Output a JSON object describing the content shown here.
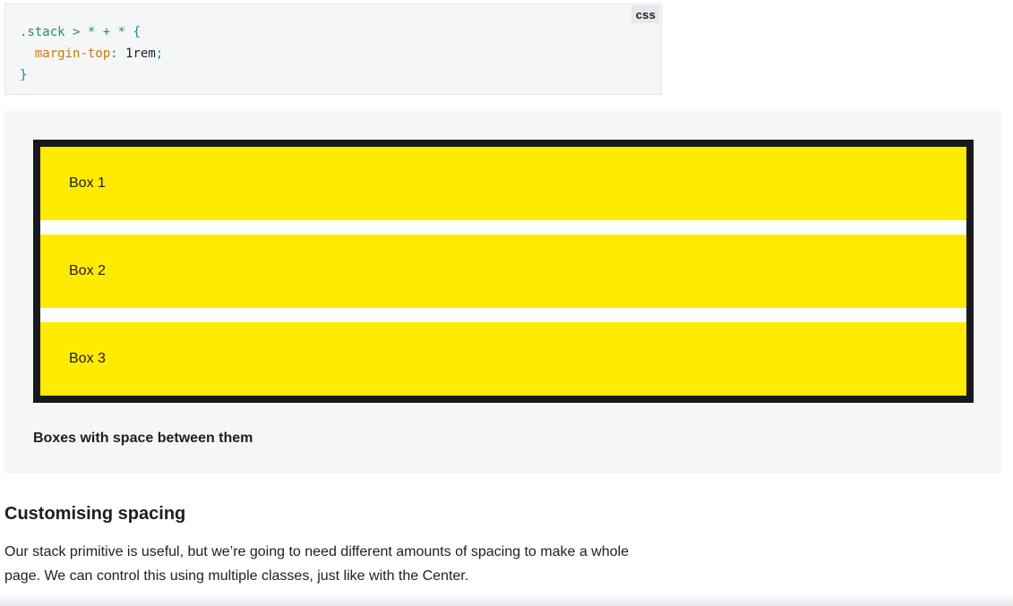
{
  "code_block": {
    "language": "css",
    "lines": {
      "l1_selector": ".stack > * + *",
      "l1_brace": "{",
      "l2_property": "margin-top",
      "l2_colon": ":",
      "l2_value": "1rem",
      "l2_semicolon": ";",
      "l3_brace": "}"
    }
  },
  "demo": {
    "boxes": [
      {
        "label": "Box 1"
      },
      {
        "label": "Box 2"
      },
      {
        "label": "Box 3"
      }
    ],
    "caption": "Boxes with space between them",
    "colors": {
      "box_fill": "#ffeb00",
      "stack_border": "#17191c",
      "panel_bg": "#f5f6f8"
    }
  },
  "section": {
    "heading": "Customising spacing",
    "body": "Our stack primitive is useful, but we’re going to need different amounts of spacing to make a whole page. We can control this using multiple classes, just like with the Center."
  }
}
